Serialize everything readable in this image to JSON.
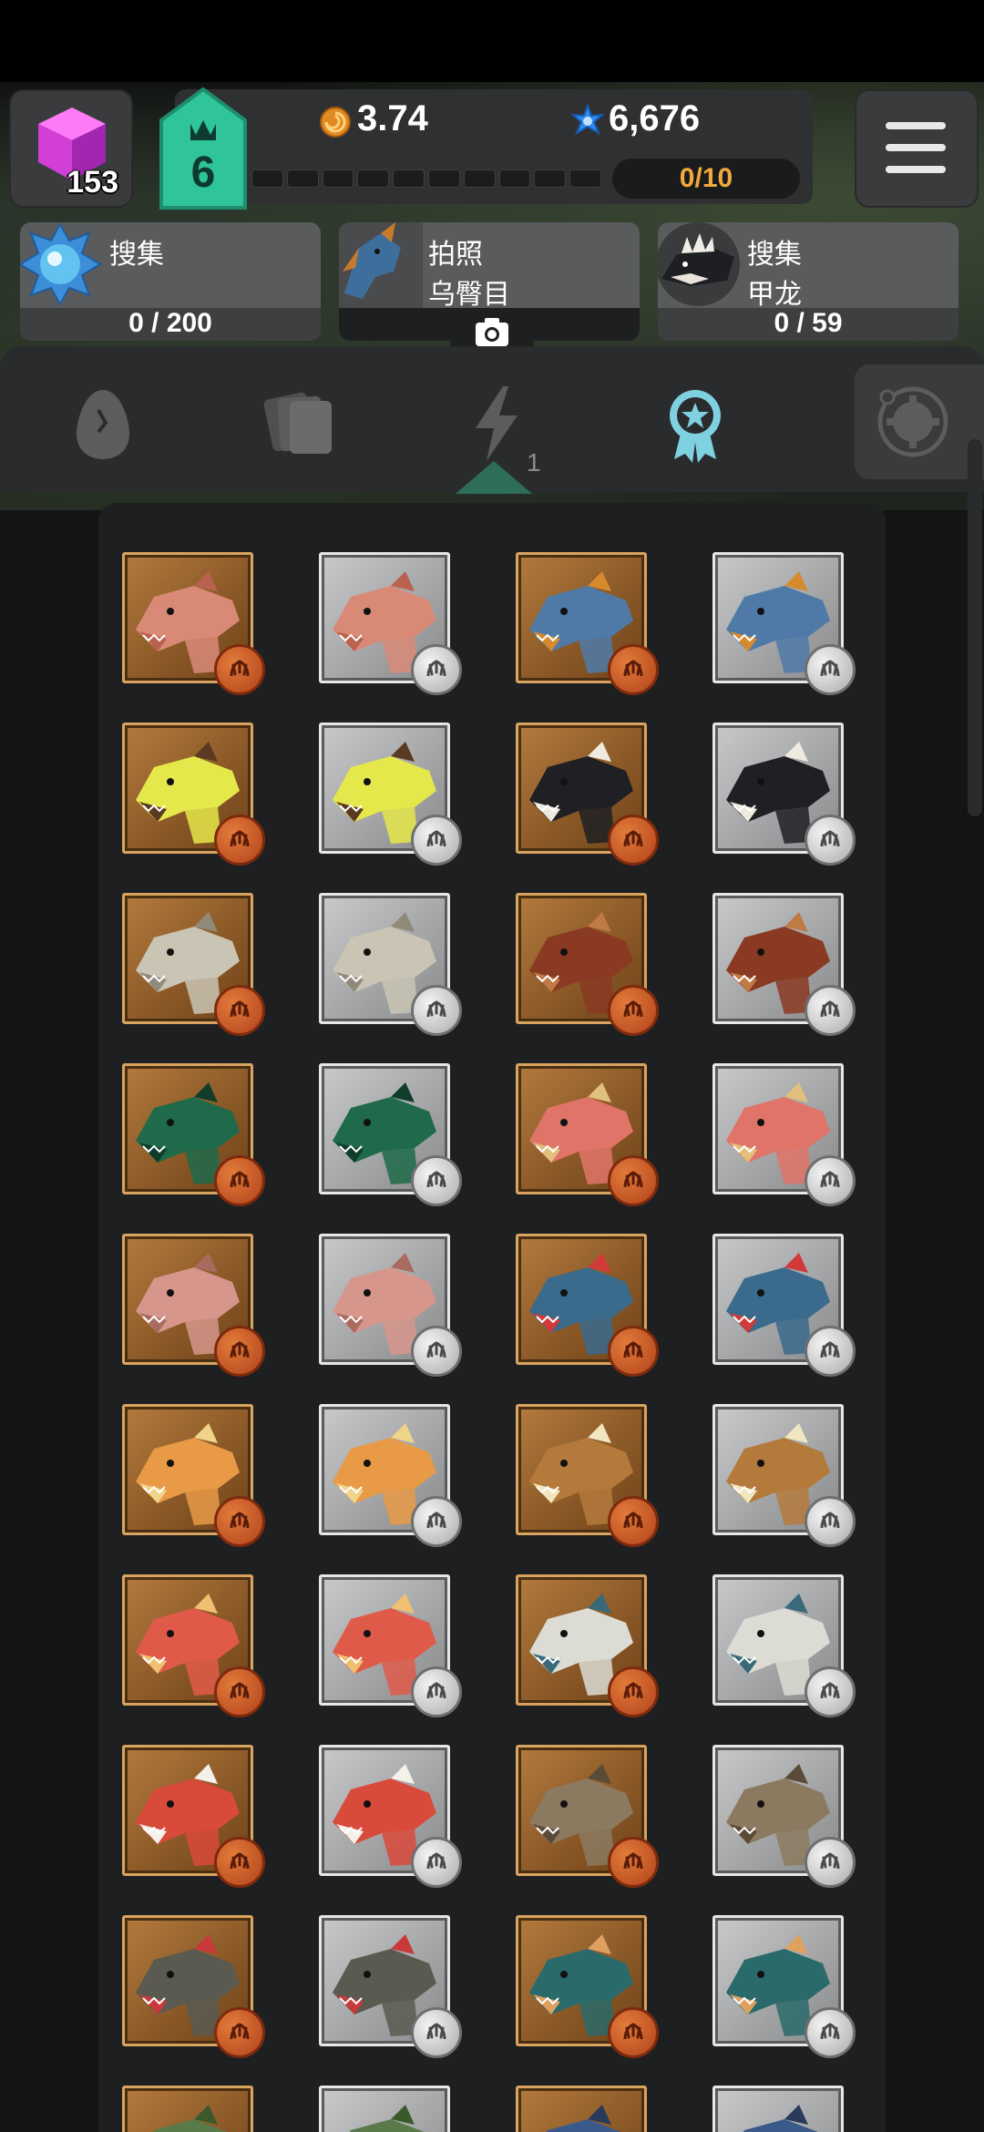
{
  "hud": {
    "gems": "153",
    "level": "6",
    "coins": "3.74",
    "stars": "6,676",
    "xp_counter": "0/10",
    "xp_progress": 0,
    "xp_segments": 10
  },
  "quests": [
    {
      "title": "搜集",
      "subtitle": "",
      "progress": "0 / 200",
      "icon": "blue-orb-icon"
    },
    {
      "title": "拍照",
      "subtitle": "乌臀目",
      "progress": "",
      "icon": "camera-icon"
    },
    {
      "title": "搜集",
      "subtitle": "甲龙",
      "progress": "0 / 59",
      "icon": "dinosaur-head-icon"
    }
  ],
  "tabs": [
    {
      "name": "egg-tab",
      "icon": "egg-icon"
    },
    {
      "name": "cards-tab",
      "icon": "cards-icon"
    },
    {
      "name": "energy-tab",
      "icon": "lightning-icon",
      "badge": "1"
    },
    {
      "name": "achievements-tab",
      "icon": "award-ribbon-icon",
      "active": true
    }
  ],
  "colors": {
    "accent_active": "#7fd0e0",
    "bronze": "#9a6530",
    "silver": "#b4b5b7",
    "level_badge": "#2fc49a",
    "xp_text": "#f2a83a"
  },
  "grid": [
    {
      "dino": "pink-crocodile-dino",
      "tier": "bronze"
    },
    {
      "dino": "pink-crocodile-dino",
      "tier": "silver"
    },
    {
      "dino": "blue-crested-dino",
      "tier": "bronze"
    },
    {
      "dino": "blue-crested-dino",
      "tier": "silver"
    },
    {
      "dino": "yellow-horned-dino",
      "tier": "bronze"
    },
    {
      "dino": "yellow-horned-dino",
      "tier": "silver"
    },
    {
      "dino": "black-white-spiked-dino",
      "tier": "bronze"
    },
    {
      "dino": "black-white-spiked-dino",
      "tier": "silver"
    },
    {
      "dino": "grey-triceratops",
      "tier": "bronze"
    },
    {
      "dino": "grey-triceratops",
      "tier": "silver"
    },
    {
      "dino": "pterosaur",
      "tier": "bronze"
    },
    {
      "dino": "pterosaur",
      "tier": "silver"
    },
    {
      "dino": "green-longneck",
      "tier": "bronze"
    },
    {
      "dino": "green-longneck",
      "tier": "silver"
    },
    {
      "dino": "red-crested-raptor",
      "tier": "bronze"
    },
    {
      "dino": "red-crested-raptor",
      "tier": "silver"
    },
    {
      "dino": "pink-longneck",
      "tier": "bronze"
    },
    {
      "dino": "pink-longneck",
      "tier": "silver"
    },
    {
      "dino": "blue-red-crested-dino",
      "tier": "bronze"
    },
    {
      "dino": "blue-red-crested-dino",
      "tier": "silver"
    },
    {
      "dino": "orange-longneck",
      "tier": "bronze"
    },
    {
      "dino": "orange-longneck",
      "tier": "silver"
    },
    {
      "dino": "spiky-brown-dino",
      "tier": "bronze"
    },
    {
      "dino": "spiky-brown-dino",
      "tier": "silver"
    },
    {
      "dino": "pachycephalosaur",
      "tier": "bronze"
    },
    {
      "dino": "pachycephalosaur",
      "tier": "silver"
    },
    {
      "dino": "white-longneck",
      "tier": "bronze"
    },
    {
      "dino": "white-longneck",
      "tier": "silver"
    },
    {
      "dino": "red-white-raptor",
      "tier": "bronze"
    },
    {
      "dino": "red-white-raptor",
      "tier": "silver"
    },
    {
      "dino": "brown-duckbill",
      "tier": "bronze"
    },
    {
      "dino": "brown-duckbill",
      "tier": "silver"
    },
    {
      "dino": "grey-spiked-trex",
      "tier": "bronze"
    },
    {
      "dino": "grey-spiked-trex",
      "tier": "silver"
    },
    {
      "dino": "teal-sailback",
      "tier": "bronze"
    },
    {
      "dino": "teal-sailback",
      "tier": "silver"
    },
    {
      "dino": "green-dino",
      "tier": "bronze"
    },
    {
      "dino": "green-dino",
      "tier": "silver"
    },
    {
      "dino": "blue-dino",
      "tier": "bronze"
    },
    {
      "dino": "blue-dino",
      "tier": "silver"
    }
  ]
}
